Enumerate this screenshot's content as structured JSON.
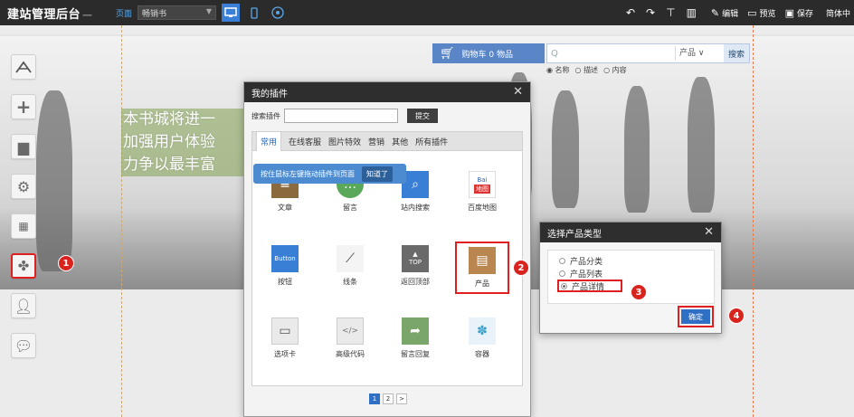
{
  "topbar": {
    "brand": "建站管理后台",
    "page_label": "页面",
    "page_select": "畅销书",
    "edit_label": "编辑",
    "preview_label": "预览",
    "save_label": "保存",
    "lang_label": "简体中"
  },
  "site": {
    "cart_label": "购物车 0 物品",
    "search_placeholder": "Q",
    "search_select": "产品",
    "search_button": "搜索",
    "search_options": [
      "名称",
      "描述",
      "内容"
    ],
    "hero_lines": [
      "本书城将进一",
      "加强用户体验",
      "力争以最丰富"
    ]
  },
  "annotations": {
    "toolbar_step": "1",
    "product_tile_step": "2",
    "detail_option_step": "3",
    "confirm_step": "4"
  },
  "plugins_dialog": {
    "title": "我的插件",
    "search_label": "搜索插件",
    "submit_label": "提交",
    "tabs": [
      "常用",
      "在线客服",
      "图片特效",
      "营销",
      "其他",
      "所有插件"
    ],
    "tooltip_text": "按住鼠标左键拖动插件到页面",
    "tooltip_button": "知道了",
    "tiles": [
      "文章",
      "留言",
      "站内搜索",
      "百度地图",
      "按钮",
      "线条",
      "返回顶部",
      "产品",
      "选项卡",
      "高级代码",
      "留言回复",
      "容器"
    ],
    "tile_icon_texts": {
      "baidu_top": "Bai",
      "baidu_bottom": "地图",
      "button": "Button",
      "top": "TOP"
    },
    "pages": [
      "1",
      "2",
      ">"
    ]
  },
  "ptype_dialog": {
    "title": "选择产品类型",
    "options": [
      "产品分类",
      "产品列表",
      "产品详情"
    ],
    "selected": 2,
    "confirm_label": "确定"
  },
  "colors": {
    "topbar_bg": "#2b2b2b",
    "accent_blue": "#2f6fc4",
    "highlight_red": "#e02020",
    "badge_red": "#d8231e"
  }
}
